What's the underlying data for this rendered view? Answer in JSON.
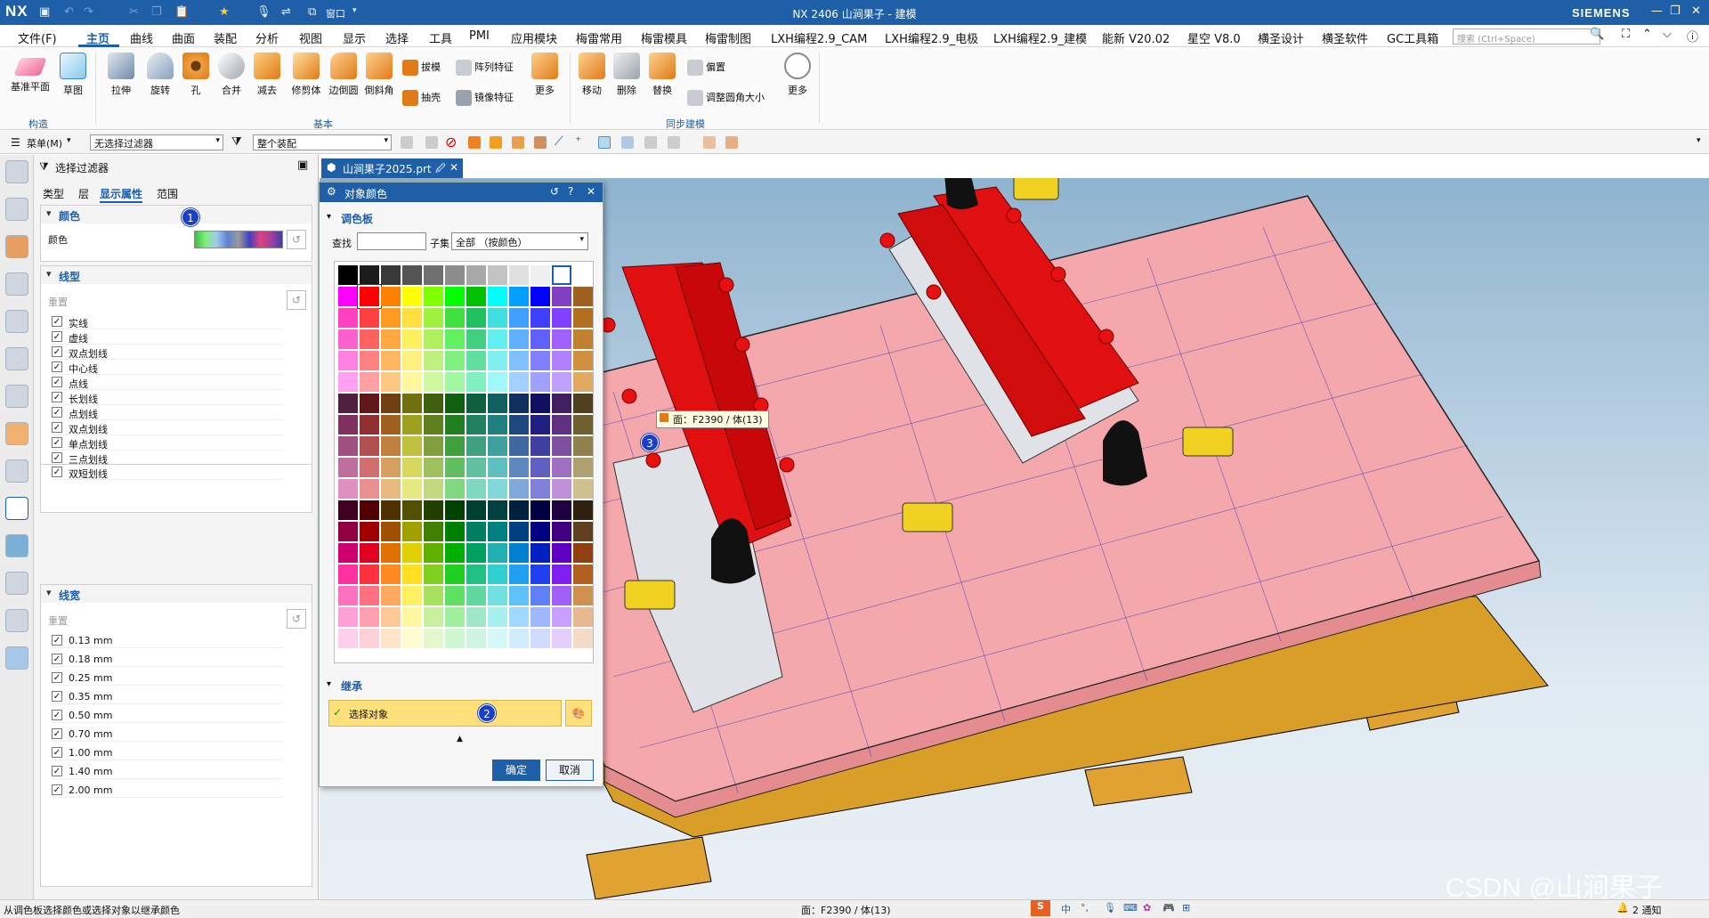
{
  "titlebar": {
    "logo": "NX",
    "window_menu": "窗口",
    "title": "NX 2406 山涧果子 - 建模",
    "vendor": "SIEMENS"
  },
  "menubar": {
    "items": [
      "文件(F)",
      "主页",
      "曲线",
      "曲面",
      "装配",
      "分析",
      "视图",
      "显示",
      "选择",
      "工具",
      "PMI",
      "应用模块",
      "梅雷常用",
      "梅雷模具",
      "梅雷制图",
      "LXH编程2.9_CAM",
      "LXH编程2.9_电极",
      "LXH编程2.9_建模",
      "能新 V20.02",
      "星空 V8.0",
      "横圣设计",
      "横圣软件",
      "GC工具箱"
    ],
    "active": "主页",
    "search_placeholder": "搜索 (Ctrl+Space)"
  },
  "ribbon": {
    "construct": {
      "items": [
        "基准平面",
        "草图"
      ],
      "group": "构造"
    },
    "basic": {
      "items": [
        "拉伸",
        "旋转",
        "孔",
        "合并",
        "减去",
        "修剪体",
        "边倒圆",
        "倒斜角"
      ],
      "small": [
        "拔模",
        "抽壳",
        "阵列特征",
        "镜像特征"
      ],
      "more": "更多",
      "group": "基本"
    },
    "sync": {
      "items": [
        "移动",
        "删除",
        "替换"
      ],
      "small": [
        "偏置",
        "调整圆角大小"
      ],
      "more": "更多",
      "group": "同步建模"
    }
  },
  "selbar": {
    "menu": "菜单(M)",
    "filter": "无选择过滤器",
    "scope": "整个装配"
  },
  "filter_panel": {
    "title": "选择过滤器",
    "tabs": [
      "类型",
      "层",
      "显示属性",
      "范围"
    ],
    "active_tab": "显示属性",
    "color_section": {
      "title": "颜色",
      "label": "颜色"
    },
    "linetype_section": {
      "title": "线型",
      "reset": "重置",
      "items": [
        "实线",
        "虚线",
        "双点划线",
        "中心线",
        "点线",
        "长划线",
        "点划线",
        "双点划线",
        "单点划线",
        "三点划线",
        "双短划线"
      ]
    },
    "linewidth_section": {
      "title": "线宽",
      "reset": "重置",
      "items": [
        "0.13 mm",
        "0.18 mm",
        "0.25 mm",
        "0.35 mm",
        "0.50 mm",
        "0.70 mm",
        "1.00 mm",
        "1.40 mm",
        "2.00 mm"
      ]
    }
  },
  "file_tab": {
    "name": "山涧果子2025.prt"
  },
  "dialog": {
    "title": "对象颜色",
    "palette_section": "调色板",
    "find_label": "查找",
    "find_value": "",
    "subset_label": "子集",
    "subset_value": "全部 （按颜色）",
    "inherit_section": "继承",
    "select_object": "选择对象",
    "ok": "确定",
    "cancel": "取消"
  },
  "palette": {
    "rows": [
      [
        "#000000",
        "#1c1c1c",
        "#383838",
        "#545454",
        "#707070",
        "#8c8c8c",
        "#a8a8a8",
        "#c4c4c4",
        "#e0e0e0",
        "#f0f0f0",
        "#ffffff"
      ],
      [
        "#ff00ff",
        "#ff0000",
        "#ff8000",
        "#ffff00",
        "#80ff00",
        "#00ff00",
        "#00c000",
        "#00ffff",
        "#00a0ff",
        "#0000ff",
        "#8040c0",
        "#a06020"
      ],
      [
        "#ff40c0",
        "#ff4040",
        "#ff9a20",
        "#ffe040",
        "#a0f040",
        "#40e040",
        "#20c060",
        "#40e0e0",
        "#40a0ff",
        "#4040ff",
        "#8040ff",
        "#b07020"
      ],
      [
        "#ff60d0",
        "#ff6060",
        "#ffa840",
        "#fff060",
        "#b0f060",
        "#60f060",
        "#40d080",
        "#60f0f0",
        "#60b0ff",
        "#6060ff",
        "#a060ff",
        "#c08030"
      ],
      [
        "#ff80e0",
        "#ff8080",
        "#ffb860",
        "#fff080",
        "#c0f080",
        "#80f080",
        "#60e0a0",
        "#80f0f0",
        "#80c0ff",
        "#8080ff",
        "#b080ff",
        "#d09040"
      ],
      [
        "#ffa0f0",
        "#ffa0a0",
        "#ffc880",
        "#fff8a0",
        "#d0f8a0",
        "#a0f8a0",
        "#80f0c0",
        "#a0f8f8",
        "#a0d0ff",
        "#a0a0ff",
        "#c0a0ff",
        "#e0a860"
      ],
      [
        "#502040",
        "#601818",
        "#704010",
        "#707010",
        "#406010",
        "#106010",
        "#106040",
        "#106060",
        "#103060",
        "#101060",
        "#402060",
        "#504020"
      ],
      [
        "#803060",
        "#903030",
        "#a06020",
        "#a0a020",
        "#608020",
        "#208020",
        "#208060",
        "#208080",
        "#204880",
        "#202080",
        "#603080",
        "#706030"
      ],
      [
        "#a05080",
        "#b05050",
        "#c08040",
        "#c0c040",
        "#80a040",
        "#40a040",
        "#40a080",
        "#40a0a0",
        "#4068a0",
        "#4040a0",
        "#8050a0",
        "#908050"
      ],
      [
        "#c070a0",
        "#d07070",
        "#d8a060",
        "#d8d860",
        "#a0c060",
        "#60c060",
        "#60c0a0",
        "#60c0c0",
        "#6088c0",
        "#6060c0",
        "#a070c0",
        "#b0a070"
      ],
      [
        "#e090c0",
        "#e89090",
        "#e8b880",
        "#e8e880",
        "#c0d880",
        "#80d880",
        "#80d8c0",
        "#80d8d8",
        "#80a8d8",
        "#8080d8",
        "#c090d8",
        "#d0c090"
      ],
      [
        "#400020",
        "#500000",
        "#503000",
        "#505000",
        "#204000",
        "#004000",
        "#004030",
        "#004040",
        "#002040",
        "#000040",
        "#200040",
        "#302010"
      ],
      [
        "#900040",
        "#a00000",
        "#a05000",
        "#a0a000",
        "#408000",
        "#008000",
        "#008060",
        "#008080",
        "#004080",
        "#000080",
        "#400080",
        "#604020"
      ],
      [
        "#d00070",
        "#e00020",
        "#e07000",
        "#e0d000",
        "#60b000",
        "#00b000",
        "#00a060",
        "#20b0b0",
        "#0080d0",
        "#0020c0",
        "#6000c0",
        "#904010"
      ],
      [
        "#ff30a0",
        "#ff3040",
        "#ff8820",
        "#ffe020",
        "#80d020",
        "#20d020",
        "#20c080",
        "#30d0d0",
        "#20a0f0",
        "#2040f0",
        "#8020f0",
        "#b06020"
      ],
      [
        "#ff70c0",
        "#ff7080",
        "#ffa860",
        "#fff060",
        "#a8e060",
        "#60e060",
        "#60d8a0",
        "#70e0e0",
        "#60c0f8",
        "#6080f8",
        "#a060f8",
        "#d09050"
      ],
      [
        "#ffa0d8",
        "#ffa0b0",
        "#ffc898",
        "#fff8a0",
        "#c8f0a0",
        "#a0f0a0",
        "#a0e8c8",
        "#a8f0f0",
        "#a0d8ff",
        "#a0b8ff",
        "#c8a0ff",
        "#e8b890"
      ],
      [
        "#ffd0ec",
        "#ffd0d8",
        "#ffe4c8",
        "#fffcd0",
        "#e4f8d0",
        "#d0f8d0",
        "#d0f4e4",
        "#d4f8f8",
        "#d0ecff",
        "#d0dcff",
        "#e4d0ff",
        "#f4dcc8"
      ]
    ],
    "selected_color": "#ff0000"
  },
  "viewport": {
    "tooltip": "面：F2390 / 体(13)",
    "watermark": "CSDN @山涧果子"
  },
  "badges": [
    "1",
    "2",
    "3"
  ],
  "statusbar": {
    "hint": "从调色板选择颜色或选择对象以继承颜色",
    "center": "面：F2390 / 体(13)",
    "notify": "2 通知"
  },
  "colors": {
    "accent": "#1e5fa8",
    "plate": "#f4a8ac",
    "block": "#e01010",
    "base": "#d9a22a"
  }
}
